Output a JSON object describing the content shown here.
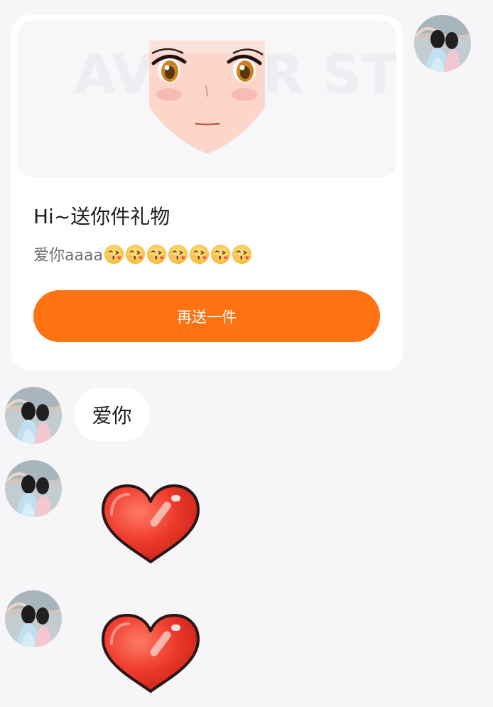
{
  "gift_card": {
    "banner_watermark": "AVATAR STORE",
    "title": "Hi~送你件礼物",
    "message": "爱你aaaa",
    "emoji_icon": "face-blowing-kiss-emoji",
    "emoji_count": 7,
    "resend_button_label": "再送一件"
  },
  "messages": [
    {
      "type": "text",
      "sender": "other",
      "text": "爱你"
    },
    {
      "type": "sticker",
      "sender": "other",
      "sticker_icon": "red-heart-sticker"
    },
    {
      "type": "sticker",
      "sender": "other",
      "sticker_icon": "red-heart-sticker"
    }
  ],
  "colors": {
    "page_background": "#f6f6f8",
    "card_background": "#ffffff",
    "accent_orange": "#fe7212",
    "primary_text": "#1c1c1e",
    "secondary_text": "#6e6e73",
    "heart_red": "#ee3a2c"
  }
}
